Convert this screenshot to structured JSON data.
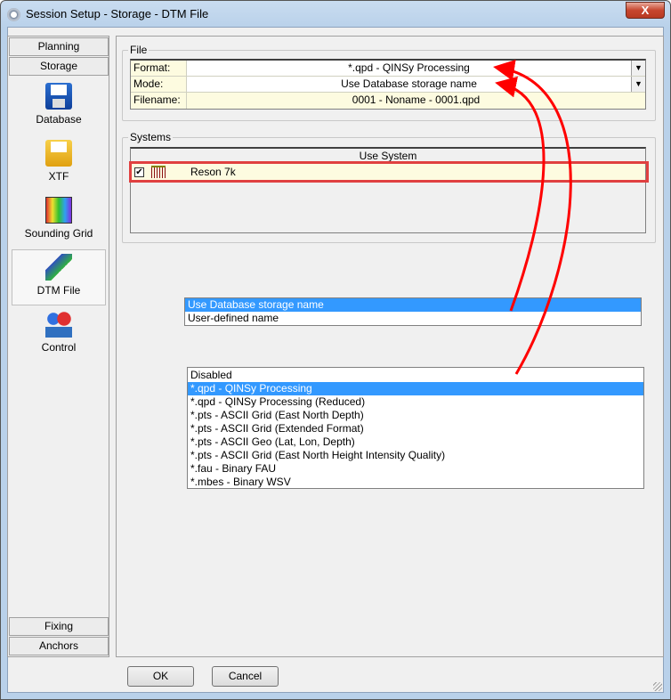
{
  "window": {
    "title": "Session Setup - Storage -  DTM File",
    "close": "X"
  },
  "nav": {
    "top": [
      "Planning",
      "Storage"
    ],
    "items": [
      {
        "label": "Database",
        "icon": "floppy-disk-icon"
      },
      {
        "label": "XTF",
        "icon": "yellow-floppy-icon"
      },
      {
        "label": "Sounding Grid",
        "icon": "sounding-grid-icon"
      },
      {
        "label": "DTM File",
        "icon": "dtm-icon"
      },
      {
        "label": "Control",
        "icon": "control-icon"
      }
    ],
    "bottom": [
      "Fixing",
      "Anchors"
    ]
  },
  "file": {
    "legend": "File",
    "rows": [
      {
        "label": "Format:",
        "value": "*.qpd - QINSy Processing"
      },
      {
        "label": "Mode:",
        "value": "Use Database storage name"
      },
      {
        "label": "Filename:",
        "value": "0001 - Noname - 0001.qpd"
      }
    ]
  },
  "systems": {
    "legend": "Systems",
    "header": "Use System",
    "rows": [
      {
        "name": "Reson 7k",
        "checked": true
      }
    ]
  },
  "mode_options": [
    "Use Database storage name",
    "User-defined name"
  ],
  "format_options": [
    "Disabled",
    "*.qpd - QINSy Processing",
    "*.qpd - QINSy Processing (Reduced)",
    "*.pts - ASCII Grid (East North Depth)",
    "*.pts - ASCII Grid (Extended Format)",
    "*.pts - ASCII Geo  (Lat, Lon,  Depth)",
    "*.pts - ASCII Grid (East North Height Intensity Quality)",
    "*.fau - Binary FAU",
    "*.mbes - Binary WSV"
  ],
  "buttons": {
    "ok": "OK",
    "cancel": "Cancel"
  },
  "colors": {
    "highlight": "#3399ff",
    "annotation": "#ff0000",
    "cell_bg": "#fdfbe0"
  }
}
